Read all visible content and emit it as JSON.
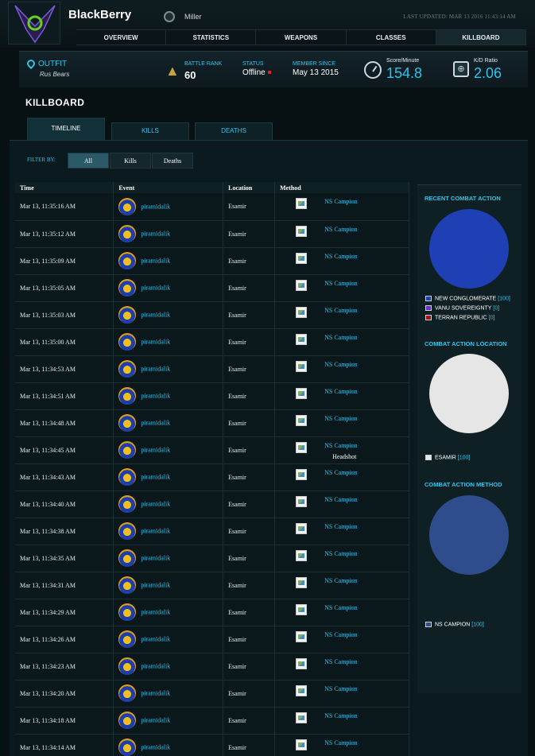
{
  "header": {
    "character_name": "BlackBerry",
    "world": "Miller",
    "last_updated": "LAST UPDATED: MAR 13 2016 11:43:14 AM"
  },
  "nav": [
    "OVERVIEW",
    "STATISTICS",
    "WEAPONS",
    "CLASSES",
    "KILLBOARD"
  ],
  "stats": {
    "outfit_label": "OUTFIT",
    "outfit_name": "Rus Bears",
    "battle_rank_label": "BATTLE RANK",
    "battle_rank": "60",
    "status_label": "STATUS",
    "status": "Offline",
    "member_since_label": "MEMBER SINCE",
    "member_since": "May 13 2015",
    "score_label": "Score/Minute",
    "score": "154.8",
    "kd_label": "K/D Ratio",
    "kd": "2.06"
  },
  "page_title": "KILLBOARD",
  "subtabs": [
    "TIMELINE",
    "KILLS",
    "DEATHS"
  ],
  "filter": {
    "label": "FILTER BY:",
    "options": [
      "All",
      "Kills",
      "Deaths"
    ]
  },
  "table": {
    "headers": [
      "Time",
      "Event",
      "Location",
      "Method"
    ],
    "rows": [
      {
        "time": "Mar 13, 11:35:16 AM",
        "name": "piramidalik",
        "location": "Esamir",
        "weapon": "NS Campion",
        "note": ""
      },
      {
        "time": "Mar 13, 11:35:12 AM",
        "name": "piramidalik",
        "location": "Esamir",
        "weapon": "NS Campion",
        "note": ""
      },
      {
        "time": "Mar 13, 11:35:09 AM",
        "name": "piramidalik",
        "location": "Esamir",
        "weapon": "NS Campion",
        "note": ""
      },
      {
        "time": "Mar 13, 11:35:05 AM",
        "name": "piramidalik",
        "location": "Esamir",
        "weapon": "NS Campion",
        "note": ""
      },
      {
        "time": "Mar 13, 11:35:03 AM",
        "name": "piramidalik",
        "location": "Esamir",
        "weapon": "NS Campion",
        "note": ""
      },
      {
        "time": "Mar 13, 11:35:00 AM",
        "name": "piramidalik",
        "location": "Esamir",
        "weapon": "NS Campion",
        "note": ""
      },
      {
        "time": "Mar 13, 11:34:53 AM",
        "name": "piramidalik",
        "location": "Esamir",
        "weapon": "NS Campion",
        "note": ""
      },
      {
        "time": "Mar 13, 11:34:51 AM",
        "name": "piramidalik",
        "location": "Esamir",
        "weapon": "NS Campion",
        "note": ""
      },
      {
        "time": "Mar 13, 11:34:48 AM",
        "name": "piramidalik",
        "location": "Esamir",
        "weapon": "NS Campion",
        "note": ""
      },
      {
        "time": "Mar 13, 11:34:45 AM",
        "name": "piramidalik",
        "location": "Esamir",
        "weapon": "NS Campion",
        "note": "Headshot"
      },
      {
        "time": "Mar 13, 11:34:43 AM",
        "name": "piramidalik",
        "location": "Esamir",
        "weapon": "NS Campion",
        "note": ""
      },
      {
        "time": "Mar 13, 11:34:40 AM",
        "name": "piramidalik",
        "location": "Esamir",
        "weapon": "NS Campion",
        "note": ""
      },
      {
        "time": "Mar 13, 11:34:38 AM",
        "name": "piramidalik",
        "location": "Esamir",
        "weapon": "NS Campion",
        "note": ""
      },
      {
        "time": "Mar 13, 11:34:35 AM",
        "name": "piramidalik",
        "location": "Esamir",
        "weapon": "NS Campion",
        "note": ""
      },
      {
        "time": "Mar 13, 11:34:31 AM",
        "name": "piramidalik",
        "location": "Esamir",
        "weapon": "NS Campion",
        "note": ""
      },
      {
        "time": "Mar 13, 11:34:29 AM",
        "name": "piramidalik",
        "location": "Esamir",
        "weapon": "NS Campion",
        "note": ""
      },
      {
        "time": "Mar 13, 11:34:26 AM",
        "name": "piramidalik",
        "location": "Esamir",
        "weapon": "NS Campion",
        "note": ""
      },
      {
        "time": "Mar 13, 11:34:23 AM",
        "name": "piramidalik",
        "location": "Esamir",
        "weapon": "NS Campion",
        "note": ""
      },
      {
        "time": "Mar 13, 11:34:20 AM",
        "name": "piramidalik",
        "location": "Esamir",
        "weapon": "NS Campion",
        "note": ""
      },
      {
        "time": "Mar 13, 11:34:18 AM",
        "name": "piramidalik",
        "location": "Esamir",
        "weapon": "NS Campion",
        "note": ""
      },
      {
        "time": "Mar 13, 11:34:14 AM",
        "name": "piramidalik",
        "location": "Esamir",
        "weapon": "NS Campion",
        "note": ""
      }
    ]
  },
  "sidebar": {
    "sections": [
      {
        "title": "RECENT COMBAT ACTION",
        "slices": [
          {
            "label": "NEW CONGLOMERATE",
            "count": "[100]",
            "value": 100,
            "color": "#1f40b5"
          },
          {
            "label": "VANU SOVEREIGNTY",
            "count": "[0]",
            "value": 0,
            "color": "#6a2fd1"
          },
          {
            "label": "TERRAN REPUBLIC",
            "count": "[0]",
            "value": 0,
            "color": "#a11414"
          }
        ]
      },
      {
        "title": "COMBAT ACTION LOCATION",
        "slices": [
          {
            "label": "ESAMIR",
            "count": "[100]",
            "value": 100,
            "color": "#e6e6e6"
          }
        ]
      },
      {
        "title": "COMBAT ACTION METHOD",
        "slices": [
          {
            "label": "NS CAMPION",
            "count": "[100]",
            "value": 100,
            "color": "#2f4d8c"
          }
        ]
      }
    ]
  }
}
